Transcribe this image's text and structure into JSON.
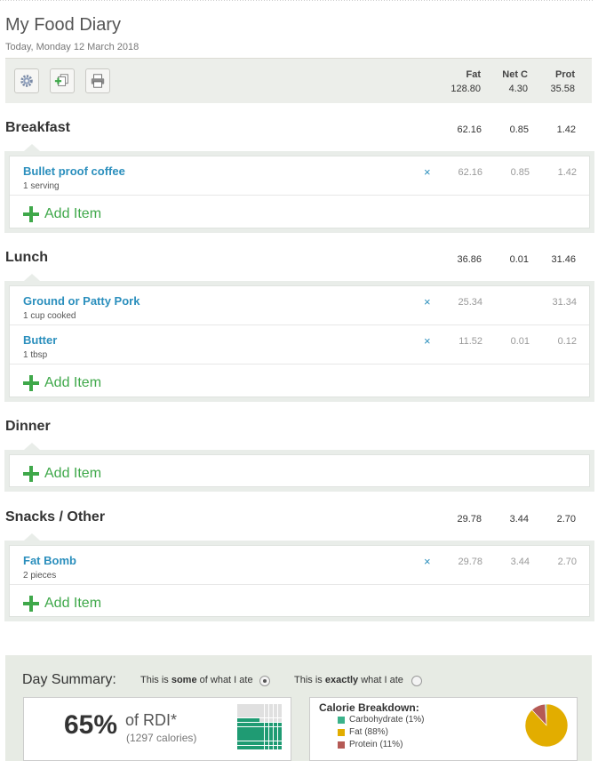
{
  "page": {
    "title": "My Food Diary",
    "date": "Today, Monday 12 March 2018"
  },
  "toolbar": {
    "buttons": [
      {
        "name": "settings-button",
        "icon": "gear-icon"
      },
      {
        "name": "copy-add-button",
        "icon": "copy-add-icon"
      },
      {
        "name": "print-button",
        "icon": "printer-icon"
      }
    ],
    "columns": [
      {
        "label": "Fat",
        "total": "128.80"
      },
      {
        "label": "Net C",
        "total": "4.30"
      },
      {
        "label": "Prot",
        "total": "35.58"
      }
    ]
  },
  "meals": {
    "breakfast": {
      "title": "Breakfast",
      "totals": [
        "62.16",
        "0.85",
        "1.42"
      ],
      "items": [
        {
          "name": "Bullet proof coffee",
          "serving": "1 serving",
          "values": [
            "62.16",
            "0.85",
            "1.42"
          ]
        }
      ]
    },
    "lunch": {
      "title": "Lunch",
      "totals": [
        "36.86",
        "0.01",
        "31.46"
      ],
      "items": [
        {
          "name": "Ground or Patty Pork",
          "serving": "1 cup cooked",
          "values": [
            "25.34",
            "",
            "31.34"
          ]
        },
        {
          "name": "Butter",
          "serving": "1 tbsp",
          "values": [
            "11.52",
            "0.01",
            "0.12"
          ]
        }
      ]
    },
    "dinner": {
      "title": "Dinner",
      "totals": [
        "",
        "",
        ""
      ],
      "items": []
    },
    "snacks": {
      "title": "Snacks / Other",
      "totals": [
        "29.78",
        "3.44",
        "2.70"
      ],
      "items": [
        {
          "name": "Fat Bomb",
          "serving": "2 pieces",
          "values": [
            "29.78",
            "3.44",
            "2.70"
          ]
        }
      ]
    }
  },
  "add_item_label": "Add Item",
  "remove_symbol": "×",
  "summary": {
    "title": "Day Summary:",
    "option_some": {
      "prefix": "This is ",
      "bold": "some",
      "suffix": " of what I ate",
      "selected": true
    },
    "option_exactly": {
      "prefix": "This is ",
      "bold": "exactly",
      "suffix": " what I ate",
      "selected": false
    },
    "rdi": {
      "percent_label": "65%",
      "of_label": "of RDI*",
      "calories_label": "(1297 calories)",
      "percent": 65
    },
    "breakdown": {
      "title": "Calorie Breakdown:",
      "items": [
        {
          "label": "Carbohydrate (1%)",
          "percent": 1,
          "color": "#3bb28a"
        },
        {
          "label": "Fat (88%)",
          "percent": 88,
          "color": "#e2ad00"
        },
        {
          "label": "Protein (11%)",
          "percent": 11,
          "color": "#b55a55"
        }
      ]
    }
  },
  "colors": {
    "link": "#2b8fbd",
    "add": "#3fa84a",
    "waffle_fill": "#1f9b73"
  }
}
